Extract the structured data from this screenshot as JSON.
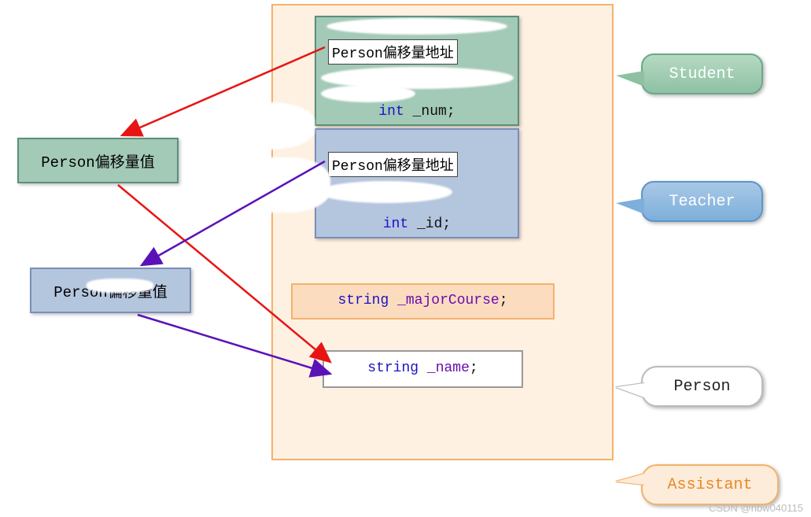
{
  "left": {
    "offset_val_1": "Person偏移量值",
    "offset_val_2": "Person偏移量值"
  },
  "student": {
    "offset_addr": "Person偏移量地址",
    "field_type": "int",
    "field_name": "_num",
    "suffix": ";"
  },
  "teacher": {
    "offset_addr": "Person偏移量地址",
    "field_type": "int",
    "field_name": "_id",
    "suffix": ";"
  },
  "assistant": {
    "field_type": "string",
    "field_name": "_majorCourse",
    "suffix": ";"
  },
  "person": {
    "field_type": "string",
    "field_name": "_name",
    "suffix": ";"
  },
  "callouts": {
    "student": "Student",
    "teacher": "Teacher",
    "person": "Person",
    "assistant": "Assistant"
  },
  "watermark": "CSDN @hbw040115"
}
